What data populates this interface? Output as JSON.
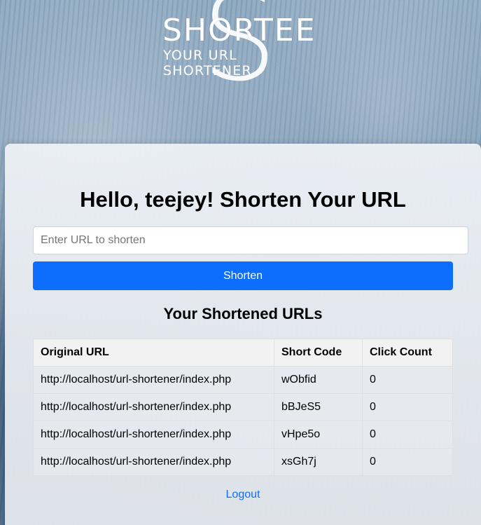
{
  "logo": {
    "letter": "S",
    "name": "SHORTEE",
    "tagline": "YOUR URL SHORTENER"
  },
  "main": {
    "heading": "Hello, teejey! Shorten Your URL",
    "url_input": {
      "value": "",
      "placeholder": "Enter URL to shorten"
    },
    "shorten_label": "Shorten",
    "list_heading": "Your Shortened URLs",
    "table": {
      "headers": [
        "Original URL",
        "Short Code",
        "Click Count"
      ],
      "rows": [
        [
          "http://localhost/url-shortener/index.php",
          "wObfid",
          "0"
        ],
        [
          "http://localhost/url-shortener/index.php",
          "bBJeS5",
          "0"
        ],
        [
          "http://localhost/url-shortener/index.php",
          "vHpe5o",
          "0"
        ],
        [
          "http://localhost/url-shortener/index.php",
          "xsGh7j",
          "0"
        ]
      ]
    },
    "logout_label": "Logout"
  },
  "colors": {
    "primary": "#0d6efd",
    "card": "#e9edf2",
    "background": "#6f8fac"
  }
}
